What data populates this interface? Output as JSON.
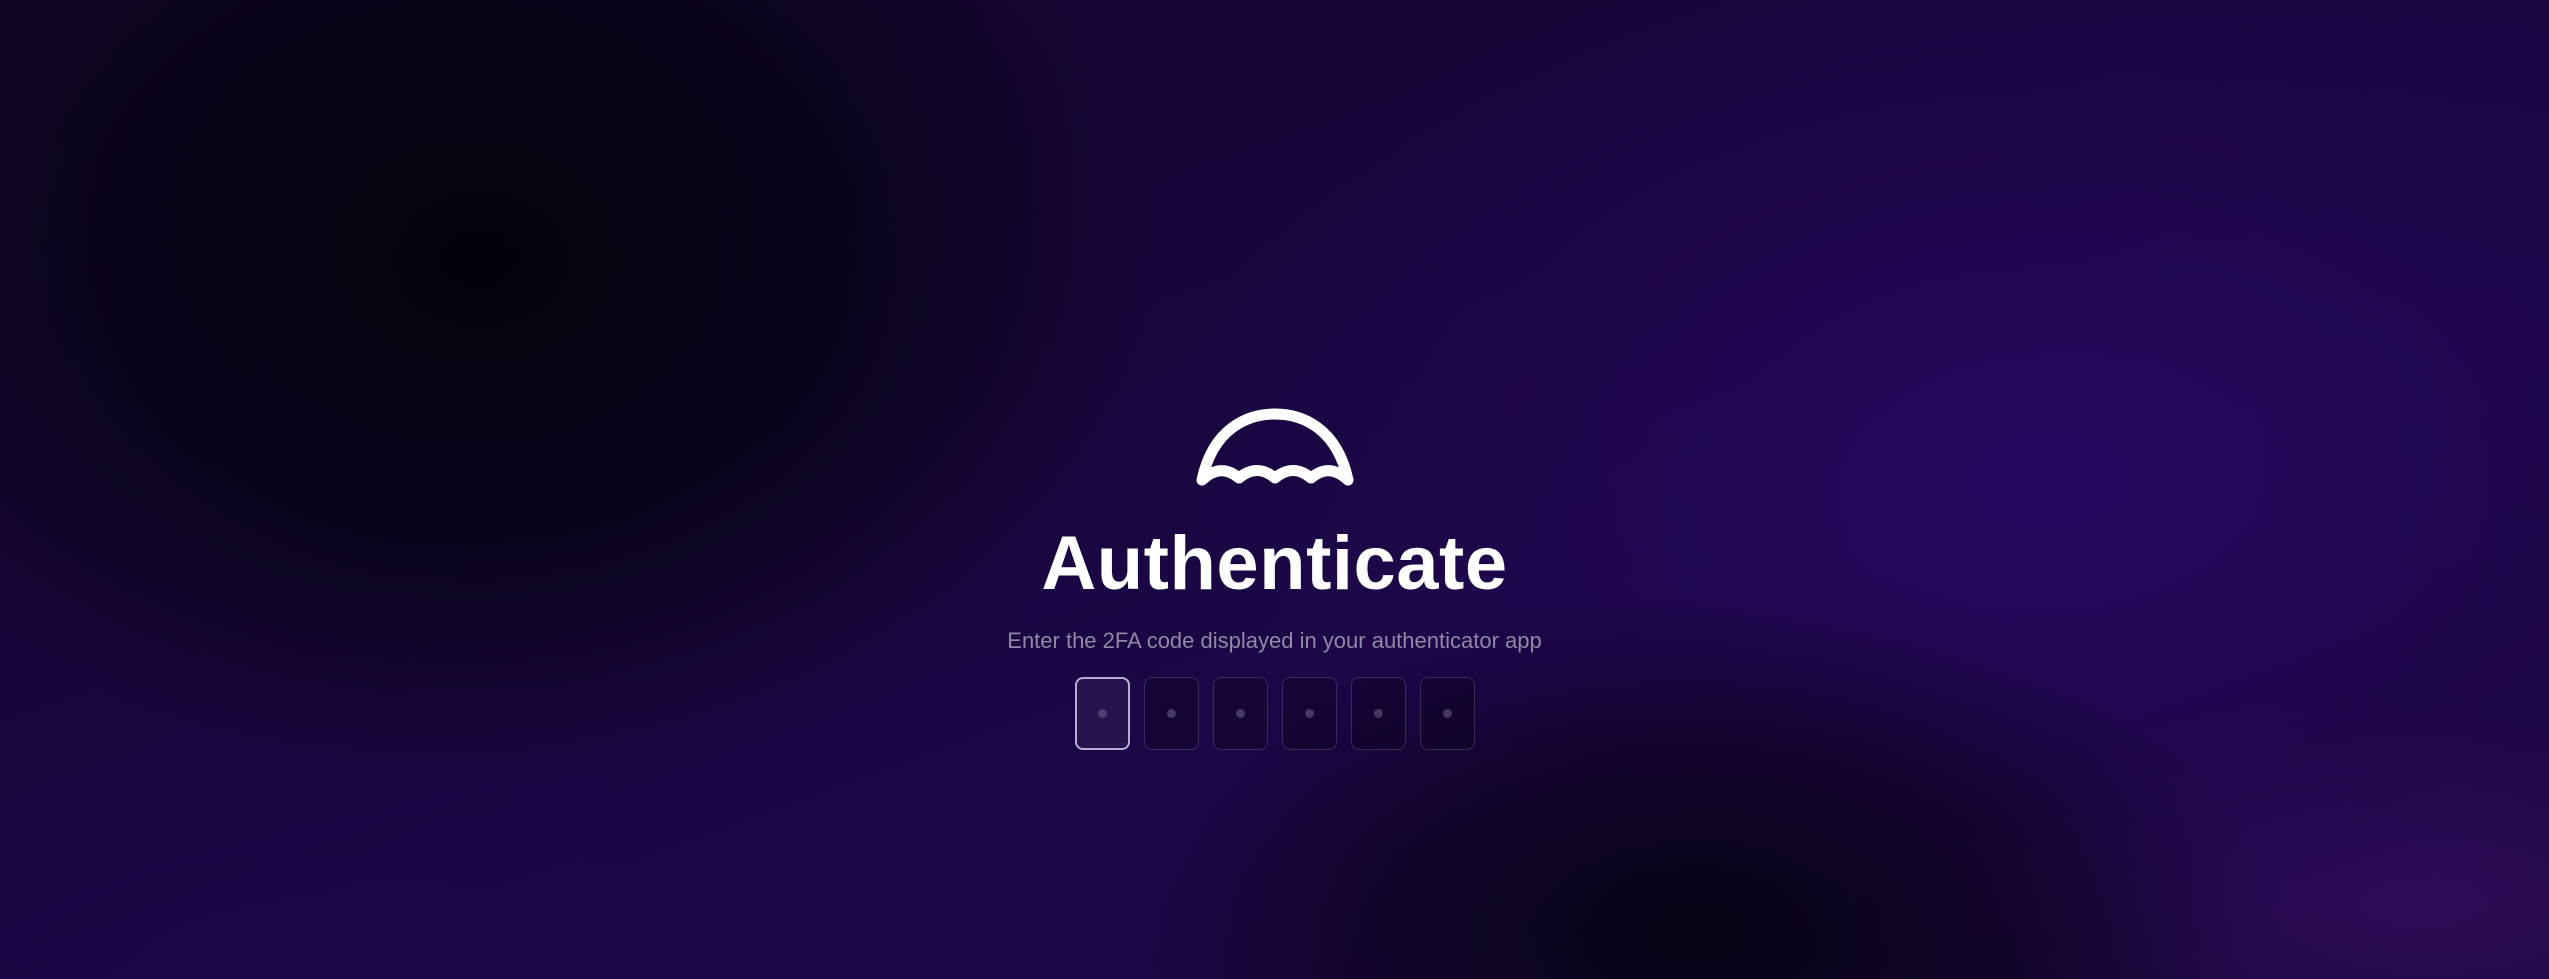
{
  "brand": {
    "logo_icon": "dome-waves-logo",
    "logo_color": "#ffffff"
  },
  "page": {
    "title": "Authenticate",
    "subtitle": "Enter the 2FA code displayed in your authenticator app"
  },
  "code_input": {
    "length": 6,
    "active_index": 0,
    "digits": [
      {
        "value": "",
        "placeholder": "•"
      },
      {
        "value": "",
        "placeholder": "•"
      },
      {
        "value": "",
        "placeholder": "•"
      },
      {
        "value": "",
        "placeholder": "•"
      },
      {
        "value": "",
        "placeholder": "•"
      },
      {
        "value": "",
        "placeholder": "•"
      }
    ]
  },
  "colors": {
    "background": "#14062c",
    "accent_glow": "#2a0a70",
    "title": "#ffffff",
    "subtitle": "#8f88a6",
    "box_border": "#5a4a7a",
    "box_active_border": "#d2c8eb"
  }
}
